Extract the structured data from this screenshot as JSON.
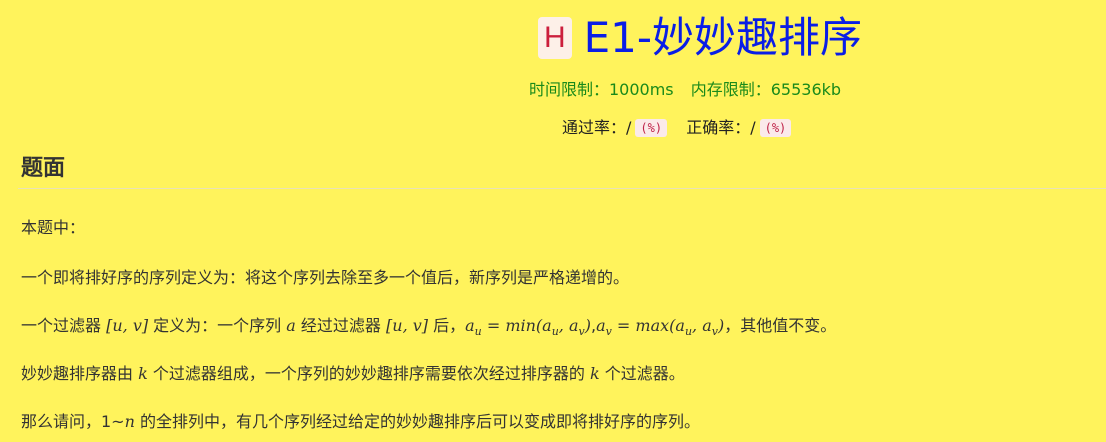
{
  "problem": {
    "level_badge": "H",
    "title": "E1-妙妙趣排序",
    "time_limit": "时间限制：1000ms",
    "memory_limit": "内存限制：65536kb",
    "pass_rate_label": "通过率：/",
    "pass_rate_pct": "(%)",
    "accuracy_label": "正确率：/",
    "accuracy_pct": "(%)"
  },
  "section": {
    "title": "题面"
  },
  "statement": {
    "p1": "本题中：",
    "p2": "一个即将排好序的序列定义为：将这个序列去除至多一个值后，新序列是严格递增的。",
    "p3_a": "一个过滤器 ",
    "p3_b": " 定义为：一个序列 ",
    "p3_c": " 经过过滤器 ",
    "p3_d": " 后，",
    "p3_e": "，其他值不变。",
    "p4_a": "妙妙趣排序器由 ",
    "p4_b": " 个过滤器组成，一个序列的妙妙趣排序需要依次经过排序器的 ",
    "p4_c": " 个过滤器。",
    "p5_a": "那么请问，1~",
    "p5_b": " 的全排列中，有几个序列经过给定的妙妙趣排序后可以变成即将排好序的序列。"
  },
  "math": {
    "filter": "[u, v]",
    "seq": "a",
    "k": "k",
    "n": "n",
    "au_lhs": "a",
    "u": "u",
    "v": "v",
    "min_fn": "min(a",
    "max_fn": "max(a",
    "eq": " = ",
    "comma": ", a",
    "close": ")"
  }
}
